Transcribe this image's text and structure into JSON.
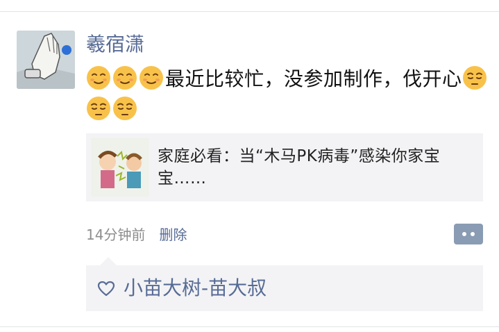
{
  "post": {
    "author": "羲宿潇",
    "leading_emoji": [
      "slightly-smiling-face-icon",
      "slightly-smiling-face-icon",
      "slightly-smiling-face-icon"
    ],
    "text": "最近比较忙，没参加制作，伐开心",
    "trailing_emoji": [
      "pensive-face-icon",
      "pensive-face-icon",
      "pensive-face-icon"
    ],
    "shared_link": {
      "title": "家庭必看：当“木马PK病毒”感染你家宝宝……"
    },
    "time_ago": "14分钟前",
    "delete_label": "删除",
    "likes": {
      "names": "小苗大树-苗大叔"
    }
  },
  "colors": {
    "link_blue": "#576b95",
    "card_bg": "#f3f3f5",
    "action_button": "#8a9bb4",
    "meta_gray": "#8d8d8d"
  }
}
